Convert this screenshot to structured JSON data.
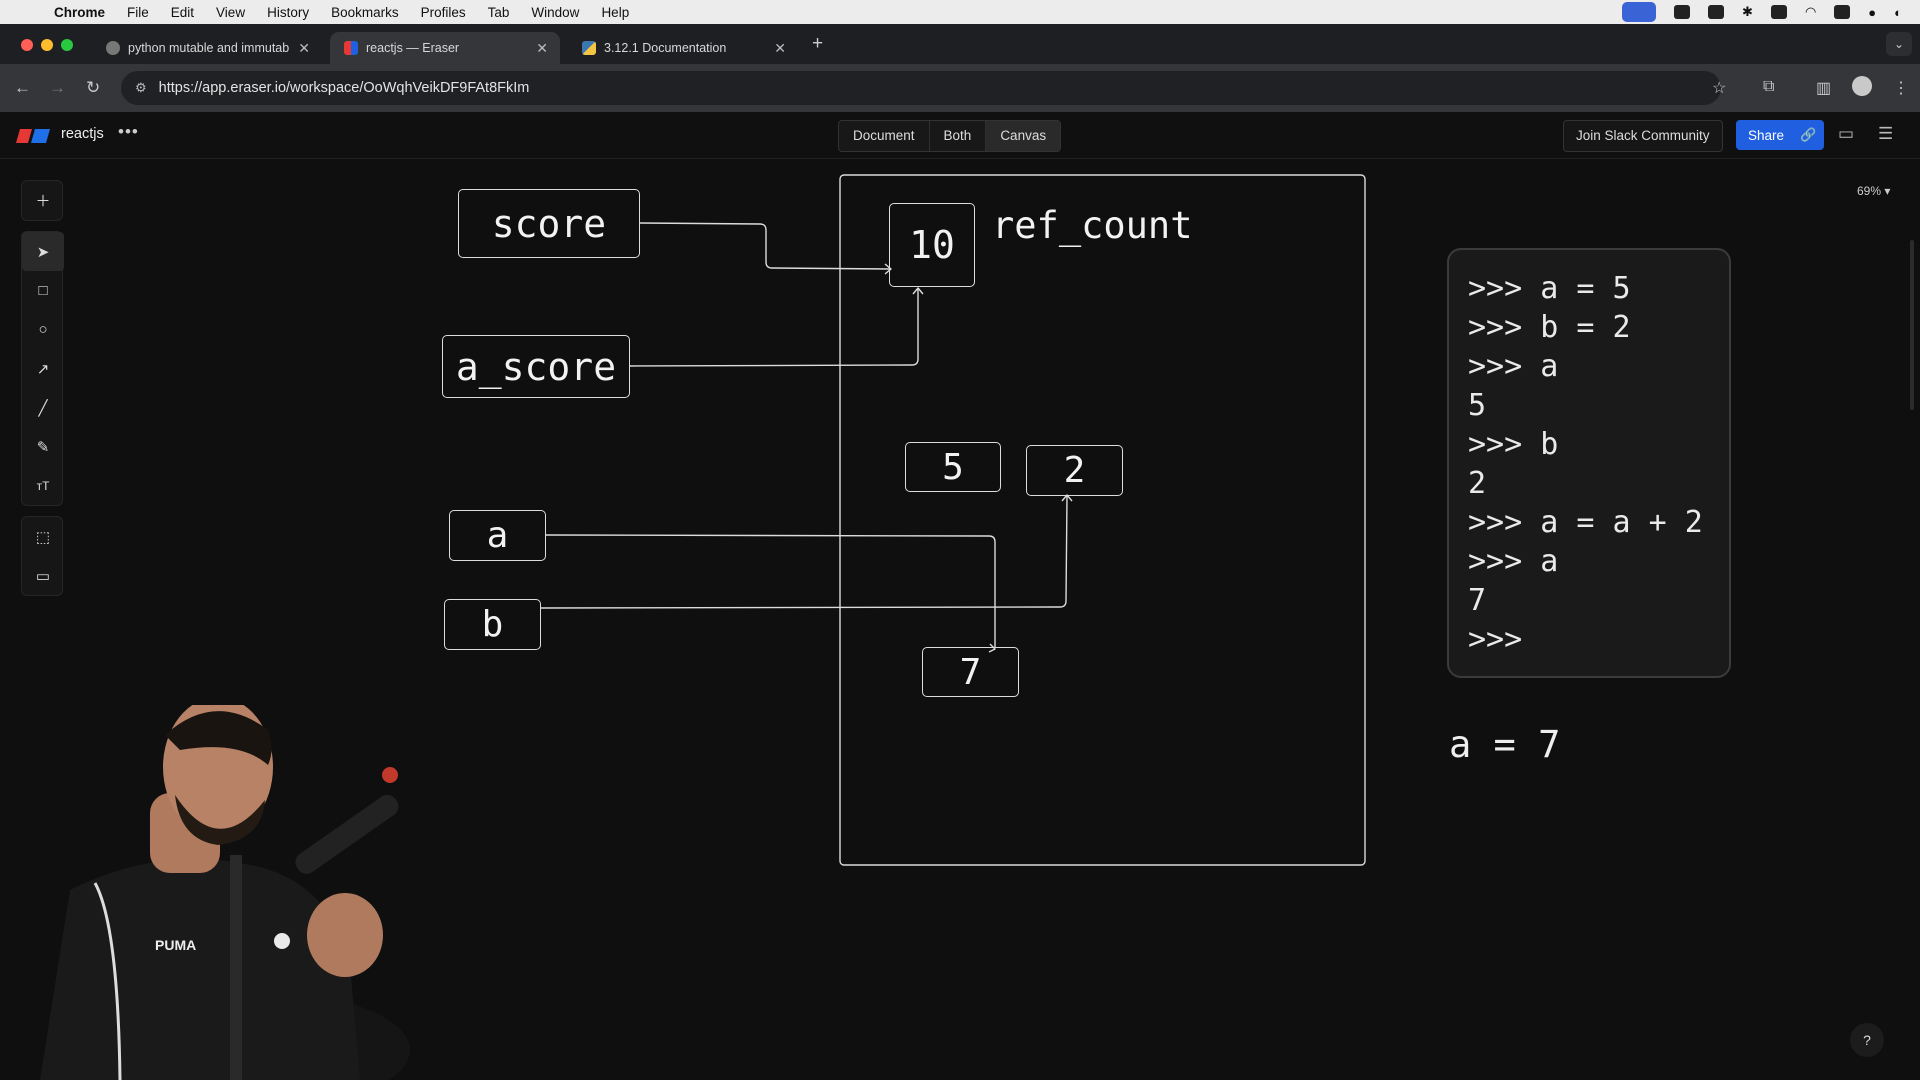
{
  "menubar": {
    "app": "Chrome",
    "items": [
      "File",
      "Edit",
      "View",
      "History",
      "Bookmarks",
      "Profiles",
      "Tab",
      "Window",
      "Help"
    ]
  },
  "tabs": [
    {
      "title": "python mutable and immutab",
      "active": false
    },
    {
      "title": "reactjs — Eraser",
      "active": true
    },
    {
      "title": "3.12.1 Documentation",
      "active": false
    }
  ],
  "address": {
    "url": "https://app.eraser.io/workspace/OoWqhVeikDF9FAt8FkIm"
  },
  "app": {
    "workspace": "reactjs",
    "more": "•••",
    "views": [
      "Document",
      "Both",
      "Canvas"
    ],
    "selected_view": "Canvas",
    "join_slack": "Join Slack Community",
    "share": "Share",
    "zoom": "69% ▾",
    "help": "?"
  },
  "diagram": {
    "labels": {
      "score": "score",
      "a_score": "a_score",
      "a": "a",
      "b": "b"
    },
    "values": {
      "ten": "10",
      "five": "5",
      "two": "2",
      "seven": "7"
    },
    "ref_count": "ref_count"
  },
  "repl": {
    "lines": [
      ">>> a = 5",
      ">>> b = 2",
      ">>> a",
      "5",
      ">>> b",
      "2",
      ">>> a = a + 2",
      ">>> a",
      "7",
      ">>>"
    ]
  },
  "note": "a = 7",
  "colors": {
    "canvas_bg": "#0f0f0f",
    "share_blue": "#1f5fe0",
    "stroke": "#dcdcdc"
  }
}
